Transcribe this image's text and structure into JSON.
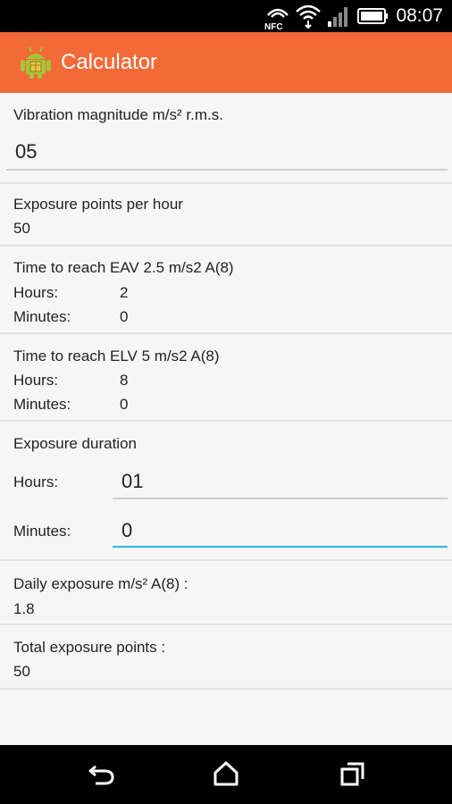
{
  "status_bar": {
    "nfc_label": "NFC",
    "time": "08:07",
    "icons": [
      "nfc-icon",
      "wifi-icon",
      "signal-icon",
      "battery-icon"
    ]
  },
  "action_bar": {
    "title": "Calculator",
    "icon": "android-app-icon",
    "color": "#f26a38"
  },
  "vibration": {
    "label": "Vibration magnitude m/s² r.m.s.",
    "value": "05"
  },
  "points_per_hour": {
    "label": "Exposure points per hour",
    "value": "50"
  },
  "eav": {
    "label": "Time to reach EAV 2.5 m/s2 A(8)",
    "hours_label": "Hours:",
    "hours_value": "2",
    "minutes_label": "Minutes:",
    "minutes_value": "0"
  },
  "elv": {
    "label": "Time to reach ELV 5 m/s2 A(8)",
    "hours_label": "Hours:",
    "hours_value": "8",
    "minutes_label": "Minutes:",
    "minutes_value": "0"
  },
  "duration": {
    "label": "Exposure duration",
    "hours_label": "Hours:",
    "hours_value": "01",
    "minutes_label": "Minutes:",
    "minutes_value": "0"
  },
  "daily_exposure": {
    "label": "Daily exposure m/s² A(8) :",
    "value": "1.8"
  },
  "total_points": {
    "label": "Total exposure points :",
    "value": "50"
  },
  "nav_bar": {
    "icons": [
      "back-icon",
      "home-icon",
      "recents-icon"
    ]
  },
  "colors": {
    "accent": "#33b5e5"
  }
}
